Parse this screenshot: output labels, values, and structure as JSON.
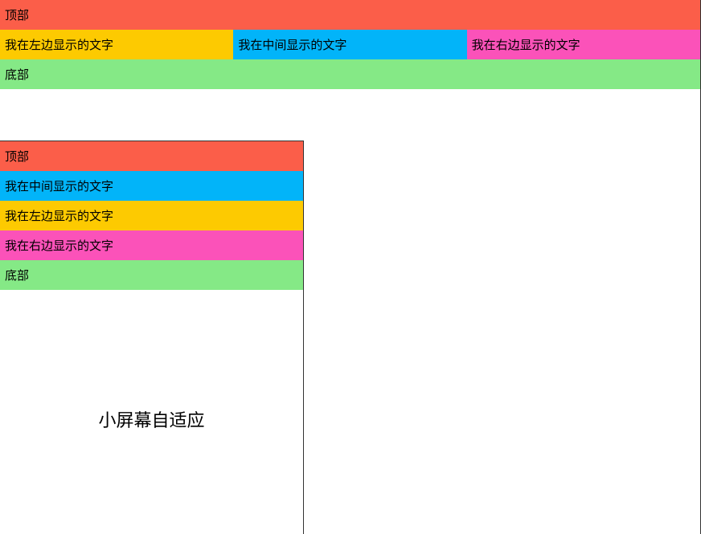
{
  "wide": {
    "header": "顶部",
    "left": "我在左边显示的文字",
    "center": "我在中间显示的文字",
    "right": "我在右边显示的文字",
    "footer": "底部"
  },
  "narrow": {
    "header": "顶部",
    "center": "我在中间显示的文字",
    "left": "我在左边显示的文字",
    "right": "我在右边显示的文字",
    "footer": "底部",
    "caption": "小屏幕自适应"
  },
  "colors": {
    "header": "#fb5e49",
    "left": "#fdca01",
    "center": "#02b4f9",
    "right": "#fb52b9",
    "footer": "#85e986"
  }
}
